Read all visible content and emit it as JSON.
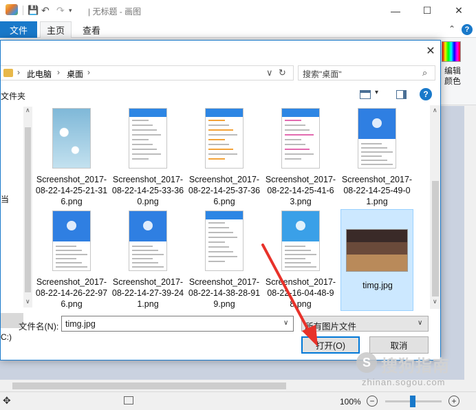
{
  "app": {
    "title": "| 无标题 - 画图",
    "tabs": {
      "file": "文件",
      "home": "主页",
      "view": "查看"
    },
    "edit_colors": "编辑颜色",
    "status": {
      "zoom": "100%"
    },
    "window_controls": {
      "minimize": "—",
      "maximize": "☐",
      "close": "✕"
    }
  },
  "dialog": {
    "close": "✕",
    "address": {
      "root": "此电脑",
      "folder": "桌面",
      "chevron": "›",
      "dropdown": "∨",
      "refresh": "↻"
    },
    "search": {
      "placeholder": "搜索\"桌面\"",
      "icon": "⌕"
    },
    "toolbar": {
      "new_folder": "文件夹",
      "help": "?"
    },
    "nav": {
      "item1": "当",
      "item2": "C:)"
    },
    "files": [
      {
        "name": "Screenshot_2017-08-22-14-25-21-316.png",
        "thumb": "snow"
      },
      {
        "name": "Screenshot_2017-08-22-14-25-33-360.png",
        "thumb": "list"
      },
      {
        "name": "Screenshot_2017-08-22-14-25-37-366.png",
        "thumb": "grid"
      },
      {
        "name": "Screenshot_2017-08-22-14-25-41-63.png",
        "thumb": "menu"
      },
      {
        "name": "Screenshot_2017-08-22-14-25-49-01.png",
        "thumb": "blue"
      },
      {
        "name": "Screenshot_2017-08-22-14-26-22-976.png",
        "thumb": "blue"
      },
      {
        "name": "Screenshot_2017-08-22-14-27-39-241.png",
        "thumb": "blue"
      },
      {
        "name": "Screenshot_2017-08-22-14-38-28-919.png",
        "thumb": "profile"
      },
      {
        "name": "Screenshot_2017-08-22-16-04-48-98.png",
        "thumb": "shield"
      },
      {
        "name": "timg.jpg",
        "thumb": "photo",
        "selected": true
      }
    ],
    "filename_label": "文件名(N):",
    "filename_value": "timg.jpg",
    "filetype_value": "所有图片文件",
    "open_button": "打开(O)",
    "cancel_button": "取消"
  },
  "watermark": {
    "logo": "S",
    "text": "搜狗指南",
    "url": "zhinan.sogou.com"
  },
  "colors": {
    "accent": "#1979ca",
    "selection": "#cce8ff",
    "arrow": "#e8322a"
  }
}
